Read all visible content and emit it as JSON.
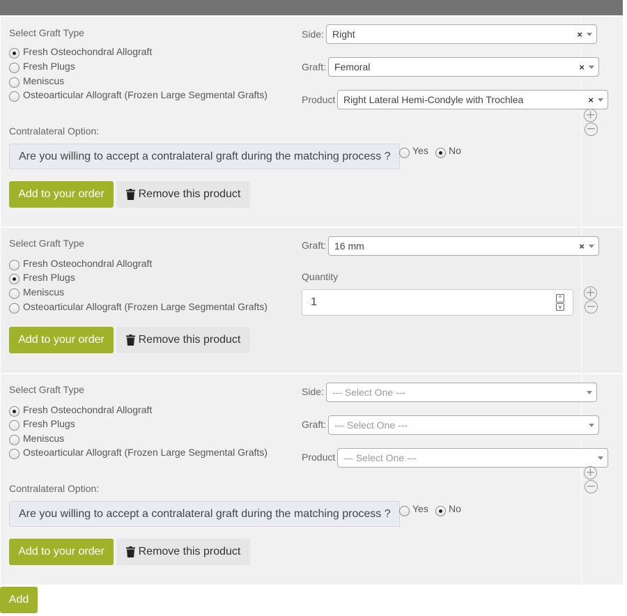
{
  "graft_type_options": [
    "Fresh Osteochondral Allograft",
    "Fresh Plugs",
    "Meniscus",
    "Osteoarticular Allograft (Frozen Large Segmental Grafts)"
  ],
  "labels": {
    "select_graft_type": "Select Graft Type",
    "side": "Side:",
    "graft": "Graft:",
    "product": "Product",
    "quantity": "Quantity",
    "contralateral_option": "Contralateral Option:",
    "contralateral_question": "Are you willing to accept a contralateral graft during the matching process ?",
    "yes": "Yes",
    "no": "No",
    "add_to_order": "Add to your order",
    "remove_product": "Remove this product",
    "add": "Add",
    "clear": "×",
    "plus": "+",
    "minus": "−"
  },
  "products": [
    {
      "selected_graft_type": "Fresh Osteochondral Allograft",
      "side": "Right",
      "graft": "Femoral",
      "product": "Right Lateral Hemi-Condyle with Trochlea",
      "contralateral": "No"
    },
    {
      "selected_graft_type": "Fresh Plugs",
      "graft": "16 mm",
      "quantity": "1"
    },
    {
      "selected_graft_type": "Fresh Osteochondral Allograft",
      "side": "--- Select One ---",
      "graft": "--- Select One ---",
      "product": "--- Select One ---",
      "contralateral": "No"
    }
  ],
  "colors": {
    "accent_green": "#a0b22a",
    "topbar": "#737373",
    "section_bg": "#f1f1f1"
  }
}
